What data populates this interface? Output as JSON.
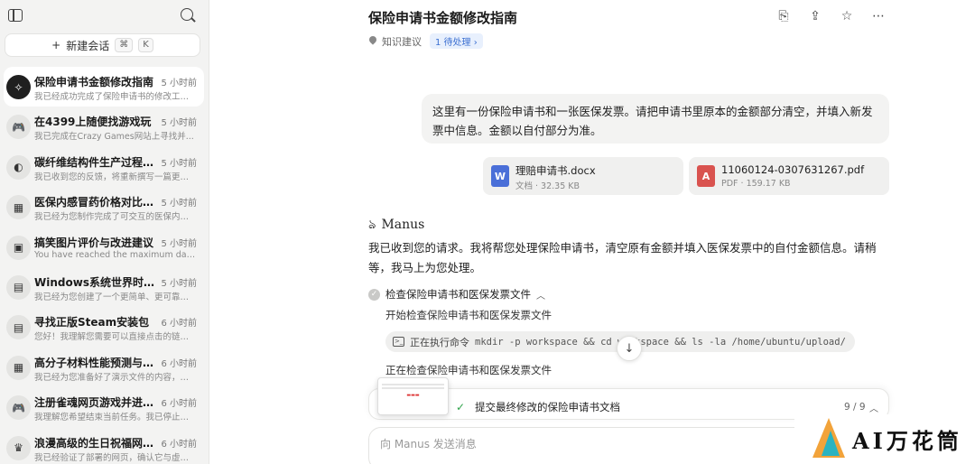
{
  "sidebar": {
    "new_chat_label": "新建会话",
    "shortcut_cmd": "⌘",
    "shortcut_key": "K",
    "items": [
      {
        "title": "保险申请书金额修改指南",
        "time": "5 小时前",
        "preview": "我已经成功完成了保险申请书的修改工作...",
        "icon": "✧",
        "active": true
      },
      {
        "title": "在4399上随便找游戏玩",
        "time": "5 小时前",
        "preview": "我已完成在Crazy Games网站上寻找并...",
        "icon": "🎮"
      },
      {
        "title": "碳纤维结构件生产过程与...",
        "time": "5 小时前",
        "preview": "我已收到您的反馈，将重新撰写一篇更具...",
        "icon": "◐"
      },
      {
        "title": "医保内感冒药价格对比图...",
        "time": "5 小时前",
        "preview": "我已经为您制作完成了可交互的医保内常...",
        "icon": "▦"
      },
      {
        "title": "搞笑图片评价与改进建议",
        "time": "5 小时前",
        "preview": "You have reached the maximum daily ...",
        "icon": "▣"
      },
      {
        "title": "Windows系统世界时钟程...",
        "time": "5 小时前",
        "preview": "我已经为您创建了一个更简单、更可靠的...",
        "icon": "▤"
      },
      {
        "title": "寻找正版Steam安装包",
        "time": "6 小时前",
        "preview": "您好！我理解您需要可以直接点击的链接...",
        "icon": "▤"
      },
      {
        "title": "高分子材料性能预测与仿...",
        "time": "6 小时前",
        "preview": "我已经为您准备好了演示文件的内容，但...",
        "icon": "▦"
      },
      {
        "title": "注册雀魂网页游戏并进行...",
        "time": "6 小时前",
        "preview": "我理解您希望结束当前任务。我已停止查...",
        "icon": "🎮"
      },
      {
        "title": "浪漫高级的生日祝福网页...",
        "time": "6 小时前",
        "preview": "我已经验证了部署的网页，确认它与虚拟...",
        "icon": "♛"
      }
    ]
  },
  "header": {
    "title": "保险申请书金额修改指南",
    "tag": "知识建议",
    "pending": "1 待处理"
  },
  "user_message": "这里有一份保险申请书和一张医保发票。请把申请书里原本的金额部分清空，并填入新发票中信息。金额以自付部分为准。",
  "attachments": [
    {
      "name": "理赔申请书.docx",
      "meta": "文档 · 32.35 KB",
      "icon": "W",
      "color": "#4a6fd8"
    },
    {
      "name": "11060124-0307631267.pdf",
      "meta": "PDF · 159.17 KB",
      "icon": "A",
      "color": "#d9534f"
    }
  ],
  "agent": {
    "name": "Manus",
    "message": "我已收到您的请求。我将帮您处理保险申请书，清空原有金额并填入医保发票中的自付金额信息。请稍等，我马上为您处理。",
    "step_title": "检查保险申请书和医保发票文件",
    "step_sub": "开始检查保险申请书和医保发票文件",
    "cmd_label": "正在执行命令",
    "cmd_code": "mkdir -p workspace && cd workspace && ls -la /home/ubuntu/upload/",
    "step_sub2": "正在检查保险申请书和医保发票文件"
  },
  "progress": {
    "text": "提交最终修改的保险申请书文档",
    "count": "9 / 9"
  },
  "input": {
    "placeholder": "向 Manus 发送消息"
  },
  "watermark": "AI万花筒"
}
